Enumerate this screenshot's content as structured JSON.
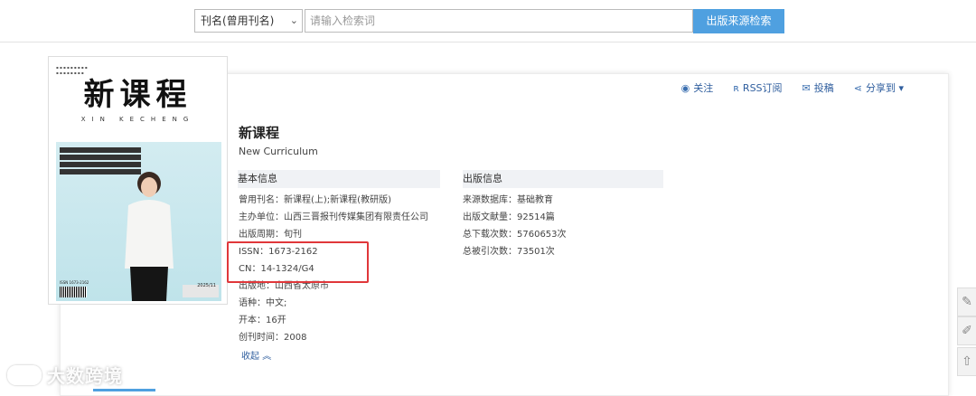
{
  "search": {
    "select_value": "刊名(曾用刊名)",
    "input_placeholder": "请输入检索词",
    "button_label": "出版来源检索"
  },
  "actions": [
    "关注",
    "RSS订阅",
    "投稿",
    "分享到"
  ],
  "cover": {
    "title": "新课程",
    "pinyin": "XIN KECHENG",
    "issn": "ISSN 1673-2162",
    "issue": "2025/11"
  },
  "journal": {
    "title": "新课程",
    "english": "New Curriculum"
  },
  "basic": {
    "header": "基本信息",
    "rows": [
      "曾用刊名：新课程(上);新课程(教研版)",
      "主办单位：山西三晋报刊传媒集团有限责任公司",
      "出版周期：旬刊",
      "ISSN：1673-2162",
      "CN：14-1324/G4",
      "出版地：山西省太原市",
      "语种：中文;",
      "开本：16开",
      "创刊时间：2008"
    ]
  },
  "publish": {
    "header": "出版信息",
    "rows": [
      "来源数据库：基础教育",
      "出版文献量：92514篇",
      "总下载次数：5760653次",
      "总被引次数：73501次"
    ]
  },
  "collapse_label": "收起",
  "watermark": "大数跨境",
  "colors": {
    "accent": "#4fa0e0",
    "highlight_box": "#e0373a",
    "link": "#2f5e9e"
  }
}
